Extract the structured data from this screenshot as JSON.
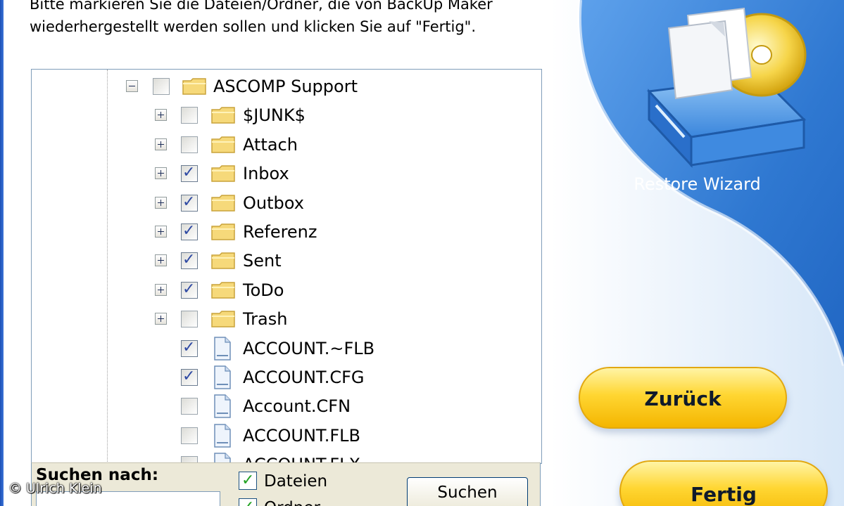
{
  "instruction": {
    "line1": "Bitte markieren Sie die Dateien/Ordner, die von BackUp Maker",
    "line2": "wiederhergestellt werden sollen und klicken Sie auf \"Fertig\"."
  },
  "tree": {
    "root": {
      "label": "ASCOMP Support",
      "checked": false,
      "expander": "minus"
    },
    "folders": [
      {
        "label": "$JUNK$",
        "checked": false
      },
      {
        "label": "Attach",
        "checked": false
      },
      {
        "label": "Inbox",
        "checked": true
      },
      {
        "label": "Outbox",
        "checked": true
      },
      {
        "label": "Referenz",
        "checked": true
      },
      {
        "label": "Sent",
        "checked": true
      },
      {
        "label": "ToDo",
        "checked": true
      },
      {
        "label": "Trash",
        "checked": false
      }
    ],
    "files": [
      {
        "label": "ACCOUNT.~FLB",
        "checked": true
      },
      {
        "label": "ACCOUNT.CFG",
        "checked": true
      },
      {
        "label": "Account.CFN",
        "checked": false
      },
      {
        "label": "ACCOUNT.FLB",
        "checked": false
      },
      {
        "label": "ACCOUNT.FLX",
        "checked": false
      }
    ]
  },
  "search": {
    "label": "Suchen nach:",
    "value": "",
    "options": [
      {
        "label": "Dateien",
        "checked": true
      },
      {
        "label": "Ordner",
        "checked": true
      }
    ],
    "button": "Suchen"
  },
  "wizard": {
    "caption": "Restore Wizard",
    "back_button": "Zurück",
    "finish_button": "Fertig"
  },
  "watermark": "© Ulrich Klein",
  "colors": {
    "checkmark": "#2e49a3",
    "option_check": "#21a121",
    "button_yellow": "#ffd632",
    "panel_blue": "#2f78d1"
  }
}
